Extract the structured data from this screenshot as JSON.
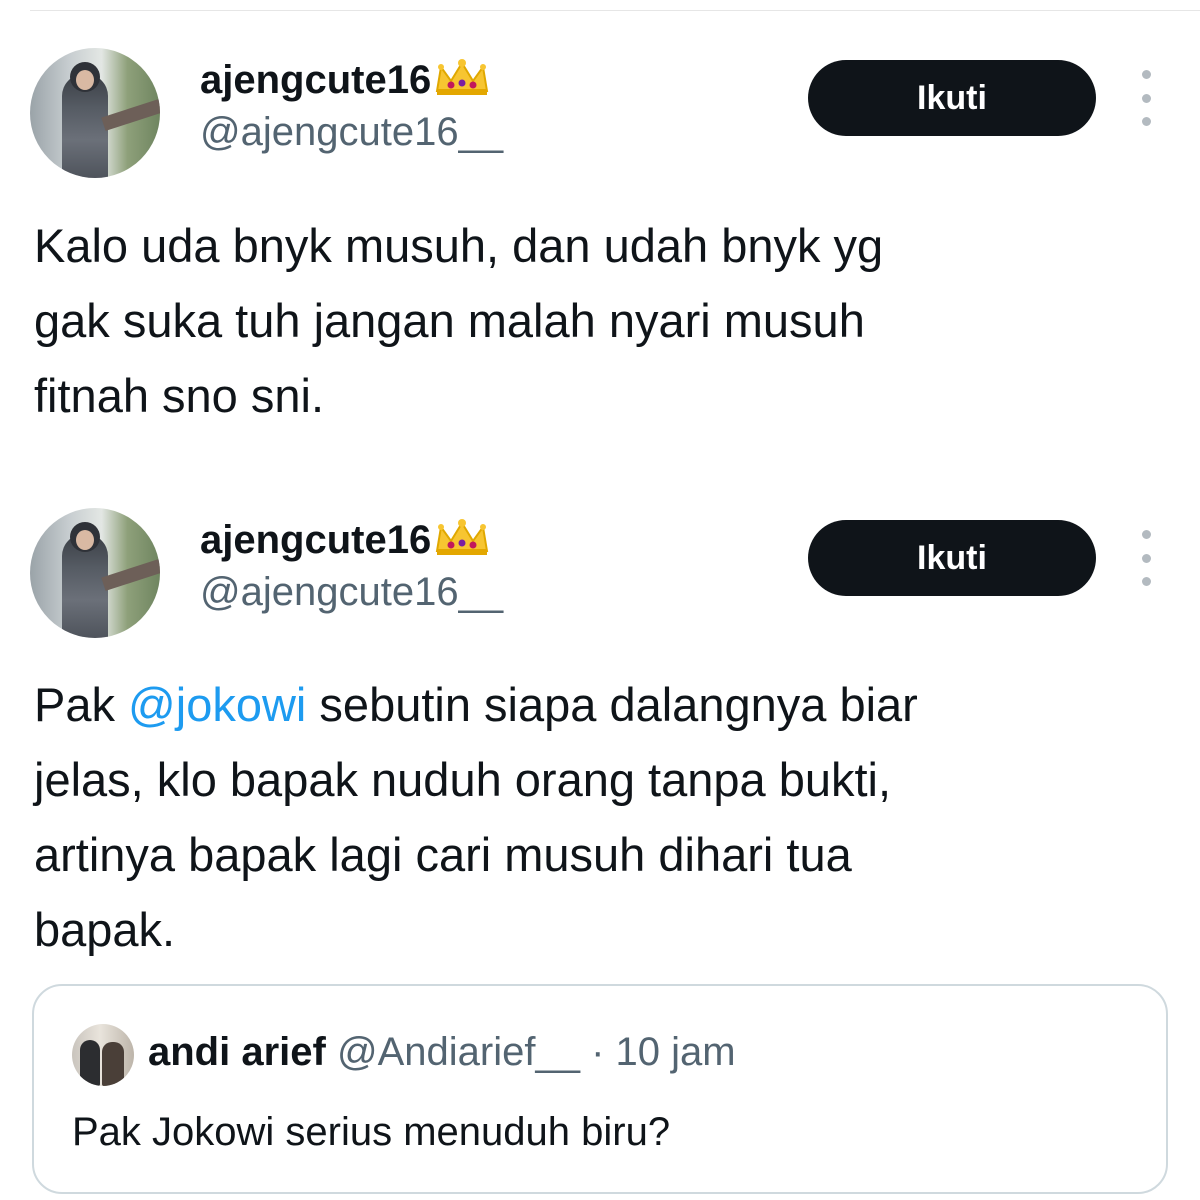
{
  "tweets": [
    {
      "author": {
        "display_name": "ajengcute16",
        "handle": "@ajengcute16__",
        "badge_emoji": "👑"
      },
      "follow_label": "Ikuti",
      "text_lines": [
        "Kalo uda bnyk musuh, dan udah bnyk yg",
        "gak suka tuh jangan malah nyari musuh",
        "fitnah sno sni."
      ]
    },
    {
      "author": {
        "display_name": "ajengcute16",
        "handle": "@ajengcute16__",
        "badge_emoji": "👑"
      },
      "follow_label": "Ikuti",
      "text_parts": {
        "prefix": "Pak ",
        "mention": "@jokowi",
        "suffix": " sebutin siapa dalangnya biar"
      },
      "text_lines": [
        "jelas, klo bapak nuduh orang tanpa bukti,",
        "artinya bapak lagi cari musuh dihari tua",
        "bapak."
      ],
      "quoted_tweet": {
        "name": "andi arief",
        "handle": "@Andiarief__",
        "time": "· 10 jam",
        "text": "Pak Jokowi serius menuduh biru?"
      }
    }
  ],
  "colors": {
    "text_primary": "#0f1419",
    "text_secondary": "#536471",
    "mention_link": "#1d9bf0",
    "follow_button_bg": "#0f1419",
    "card_border": "#cfd9de"
  },
  "icons": [
    "crown-icon",
    "more-options-icon",
    "avatar-photo"
  ]
}
